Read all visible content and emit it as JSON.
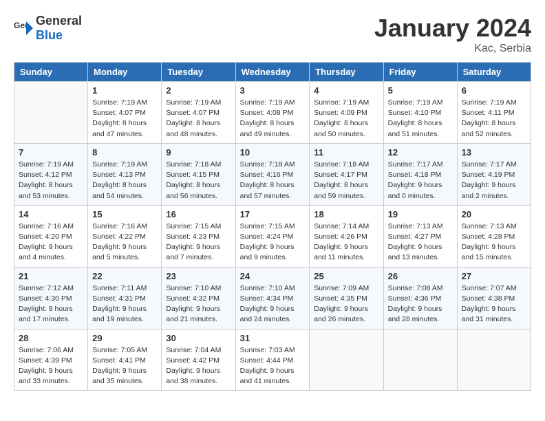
{
  "header": {
    "logo_general": "General",
    "logo_blue": "Blue",
    "title": "January 2024",
    "location": "Kac, Serbia"
  },
  "weekdays": [
    "Sunday",
    "Monday",
    "Tuesday",
    "Wednesday",
    "Thursday",
    "Friday",
    "Saturday"
  ],
  "weeks": [
    [
      {
        "day": "",
        "info": ""
      },
      {
        "day": "1",
        "info": "Sunrise: 7:19 AM\nSunset: 4:07 PM\nDaylight: 8 hours\nand 47 minutes."
      },
      {
        "day": "2",
        "info": "Sunrise: 7:19 AM\nSunset: 4:07 PM\nDaylight: 8 hours\nand 48 minutes."
      },
      {
        "day": "3",
        "info": "Sunrise: 7:19 AM\nSunset: 4:08 PM\nDaylight: 8 hours\nand 49 minutes."
      },
      {
        "day": "4",
        "info": "Sunrise: 7:19 AM\nSunset: 4:09 PM\nDaylight: 8 hours\nand 50 minutes."
      },
      {
        "day": "5",
        "info": "Sunrise: 7:19 AM\nSunset: 4:10 PM\nDaylight: 8 hours\nand 51 minutes."
      },
      {
        "day": "6",
        "info": "Sunrise: 7:19 AM\nSunset: 4:11 PM\nDaylight: 8 hours\nand 52 minutes."
      }
    ],
    [
      {
        "day": "7",
        "info": "Sunrise: 7:19 AM\nSunset: 4:12 PM\nDaylight: 8 hours\nand 53 minutes."
      },
      {
        "day": "8",
        "info": "Sunrise: 7:19 AM\nSunset: 4:13 PM\nDaylight: 8 hours\nand 54 minutes."
      },
      {
        "day": "9",
        "info": "Sunrise: 7:18 AM\nSunset: 4:15 PM\nDaylight: 8 hours\nand 56 minutes."
      },
      {
        "day": "10",
        "info": "Sunrise: 7:18 AM\nSunset: 4:16 PM\nDaylight: 8 hours\nand 57 minutes."
      },
      {
        "day": "11",
        "info": "Sunrise: 7:18 AM\nSunset: 4:17 PM\nDaylight: 8 hours\nand 59 minutes."
      },
      {
        "day": "12",
        "info": "Sunrise: 7:17 AM\nSunset: 4:18 PM\nDaylight: 9 hours\nand 0 minutes."
      },
      {
        "day": "13",
        "info": "Sunrise: 7:17 AM\nSunset: 4:19 PM\nDaylight: 9 hours\nand 2 minutes."
      }
    ],
    [
      {
        "day": "14",
        "info": "Sunrise: 7:16 AM\nSunset: 4:20 PM\nDaylight: 9 hours\nand 4 minutes."
      },
      {
        "day": "15",
        "info": "Sunrise: 7:16 AM\nSunset: 4:22 PM\nDaylight: 9 hours\nand 5 minutes."
      },
      {
        "day": "16",
        "info": "Sunrise: 7:15 AM\nSunset: 4:23 PM\nDaylight: 9 hours\nand 7 minutes."
      },
      {
        "day": "17",
        "info": "Sunrise: 7:15 AM\nSunset: 4:24 PM\nDaylight: 9 hours\nand 9 minutes."
      },
      {
        "day": "18",
        "info": "Sunrise: 7:14 AM\nSunset: 4:26 PM\nDaylight: 9 hours\nand 11 minutes."
      },
      {
        "day": "19",
        "info": "Sunrise: 7:13 AM\nSunset: 4:27 PM\nDaylight: 9 hours\nand 13 minutes."
      },
      {
        "day": "20",
        "info": "Sunrise: 7:13 AM\nSunset: 4:28 PM\nDaylight: 9 hours\nand 15 minutes."
      }
    ],
    [
      {
        "day": "21",
        "info": "Sunrise: 7:12 AM\nSunset: 4:30 PM\nDaylight: 9 hours\nand 17 minutes."
      },
      {
        "day": "22",
        "info": "Sunrise: 7:11 AM\nSunset: 4:31 PM\nDaylight: 9 hours\nand 19 minutes."
      },
      {
        "day": "23",
        "info": "Sunrise: 7:10 AM\nSunset: 4:32 PM\nDaylight: 9 hours\nand 21 minutes."
      },
      {
        "day": "24",
        "info": "Sunrise: 7:10 AM\nSunset: 4:34 PM\nDaylight: 9 hours\nand 24 minutes."
      },
      {
        "day": "25",
        "info": "Sunrise: 7:09 AM\nSunset: 4:35 PM\nDaylight: 9 hours\nand 26 minutes."
      },
      {
        "day": "26",
        "info": "Sunrise: 7:08 AM\nSunset: 4:36 PM\nDaylight: 9 hours\nand 28 minutes."
      },
      {
        "day": "27",
        "info": "Sunrise: 7:07 AM\nSunset: 4:38 PM\nDaylight: 9 hours\nand 31 minutes."
      }
    ],
    [
      {
        "day": "28",
        "info": "Sunrise: 7:06 AM\nSunset: 4:39 PM\nDaylight: 9 hours\nand 33 minutes."
      },
      {
        "day": "29",
        "info": "Sunrise: 7:05 AM\nSunset: 4:41 PM\nDaylight: 9 hours\nand 35 minutes."
      },
      {
        "day": "30",
        "info": "Sunrise: 7:04 AM\nSunset: 4:42 PM\nDaylight: 9 hours\nand 38 minutes."
      },
      {
        "day": "31",
        "info": "Sunrise: 7:03 AM\nSunset: 4:44 PM\nDaylight: 9 hours\nand 41 minutes."
      },
      {
        "day": "",
        "info": ""
      },
      {
        "day": "",
        "info": ""
      },
      {
        "day": "",
        "info": ""
      }
    ]
  ]
}
